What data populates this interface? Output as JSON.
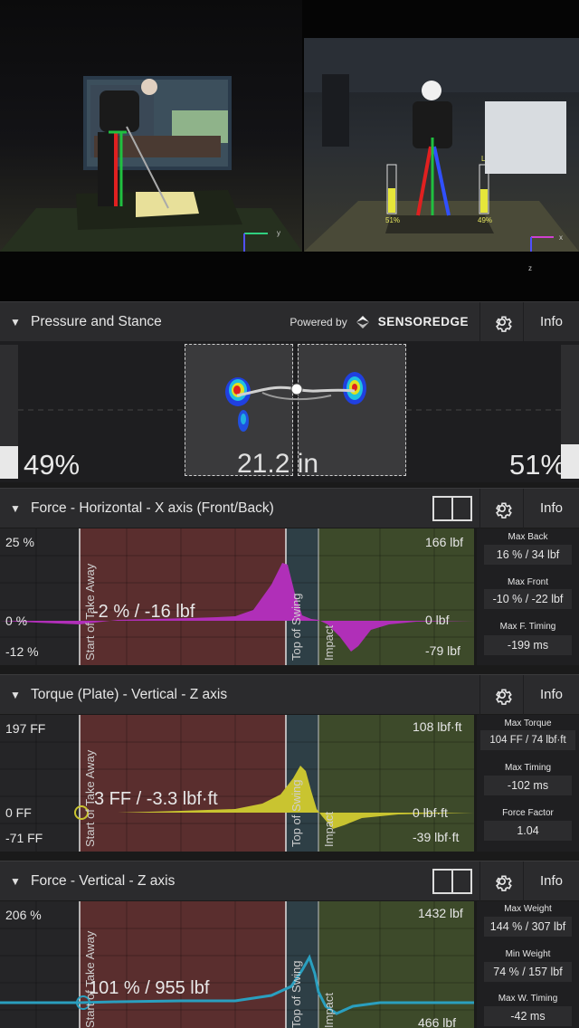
{
  "video": {
    "left_axis": {
      "y": "y",
      "z": "z"
    },
    "right_axis": {
      "x": "x",
      "z": "z"
    },
    "left_foot_pct": "51%",
    "right_foot_pct": "49%",
    "right_bar_label": "L"
  },
  "pressure": {
    "title": "Pressure and Stance",
    "powered_by": "Powered by",
    "brand": "SENSOREDGE",
    "info": "Info",
    "left_pct": "49%",
    "right_pct": "51%",
    "left_level": 0.49,
    "right_level": 0.51,
    "stance_width": "21.2 in",
    "icons": {
      "caret": "caret-down-icon",
      "settings": "gear-icon",
      "brand": "sensoredge-logo-icon"
    }
  },
  "force_x": {
    "title": "Force - Horizontal - X axis (Front/Back)",
    "info": "Info",
    "top_left": "25 %",
    "zero_left": "0 %",
    "bottom_left": "-12 %",
    "top_right": "166 lbf",
    "zero_right": "0 lbf",
    "bottom_right": "-79 lbf",
    "cursor_value": "-2 % / -16 lbf",
    "phase_labels": {
      "take_away": "Start of Take Away",
      "top": "Top of Swing",
      "impact": "Impact"
    },
    "stats": [
      {
        "label": "Max Back",
        "value": "16 % / 34 lbf"
      },
      {
        "label": "Max Front",
        "value": "-10 % / -22 lbf"
      },
      {
        "label": "Max F. Timing",
        "value": "-199 ms"
      }
    ]
  },
  "torque_z": {
    "title": "Torque (Plate) - Vertical - Z axis",
    "info": "Info",
    "top_left": "197 FF",
    "zero_left": "0 FF",
    "bottom_left": "-71 FF",
    "top_right": "108 lbf·ft",
    "zero_right": "0 lbf·ft",
    "bottom_right": "-39 lbf·ft",
    "cursor_value": "3 FF / -3.3 lbf·ft",
    "phase_labels": {
      "take_away": "Start of Take Away",
      "top": "Top of Swing",
      "impact": "Impact"
    },
    "stats": [
      {
        "label": "Max Torque",
        "value": "104 FF / 74 lbf·ft"
      },
      {
        "label": "Max Timing",
        "value": "-102 ms"
      },
      {
        "label": "Force Factor",
        "value": "1.04"
      }
    ]
  },
  "force_z": {
    "title": "Force - Vertical - Z axis",
    "info": "Info",
    "top_left": "206 %",
    "top_right": "1432 lbf",
    "bottom_right": "466 lbf",
    "cursor_value": "101 % / 955 lbf",
    "phase_labels": {
      "take_away": "Start of Take Away",
      "top": "Top of Swing",
      "impact": "Impact"
    },
    "stats": [
      {
        "label": "Max Weight",
        "value": "144 % / 307 lbf"
      },
      {
        "label": "Min Weight",
        "value": "74 % / 157 lbf"
      },
      {
        "label": "Max W. Timing",
        "value": "-42 ms"
      }
    ]
  },
  "colors": {
    "force_x_line": "#b02fb8",
    "torque_line": "#c9c430",
    "force_z_line": "#2a9fbf",
    "backswing_zone": "#5a2e2e",
    "downswing_zone": "#2e3f46",
    "follow_zone": "#3d4a2a"
  }
}
